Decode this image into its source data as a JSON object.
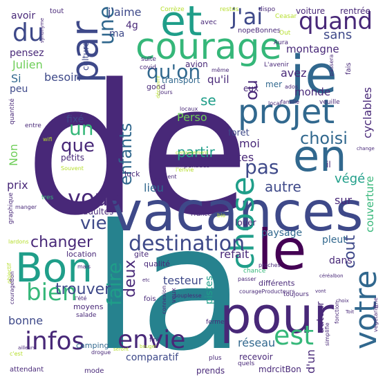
{
  "palette": {
    "dark": "#440154",
    "purple": "#482878",
    "indigo": "#3e4989",
    "blue": "#31688e",
    "teal": "#26828e",
    "green": "#1f9e89",
    "lime": "#35b779",
    "lightgreen": "#6ece58",
    "yellow": "#b5de2b",
    "brightyellow": "#fde725"
  },
  "words": [
    {
      "text": "de",
      "color": "purple"
    },
    {
      "text": "la",
      "color": "teal"
    },
    {
      "text": "vacances",
      "color": "indigo"
    },
    {
      "text": "pour",
      "color": "purple"
    },
    {
      "text": "courage",
      "color": "lime"
    },
    {
      "text": "et",
      "color": "green"
    },
    {
      "text": "je",
      "color": "blue"
    },
    {
      "text": "Bon",
      "color": "green"
    },
    {
      "text": "le",
      "color": "dark"
    },
    {
      "text": "en",
      "color": "blue"
    },
    {
      "text": "par",
      "color": "indigo"
    },
    {
      "text": "projet",
      "color": "blue"
    },
    {
      "text": "chose",
      "color": "green"
    },
    {
      "text": "votre",
      "color": "blue"
    },
    {
      "text": "du",
      "color": "indigo"
    },
    {
      "text": "quand",
      "color": "purple"
    },
    {
      "text": "j'ai",
      "color": "indigo"
    },
    {
      "text": "une",
      "color": "blue"
    },
    {
      "text": "qu'on",
      "color": "blue"
    },
    {
      "text": "destination",
      "color": "indigo"
    },
    {
      "text": "envie",
      "color": "purple"
    },
    {
      "text": "infos",
      "color": "purple"
    },
    {
      "text": "est",
      "color": "lime"
    },
    {
      "text": "bien",
      "color": "lime"
    },
    {
      "text": "faire",
      "color": "green"
    },
    {
      "text": "vous",
      "color": "purple"
    },
    {
      "text": "vie",
      "color": "indigo"
    },
    {
      "text": "pas",
      "color": "indigo"
    },
    {
      "text": "enfants",
      "color": "blue"
    },
    {
      "text": "un",
      "color": "lime"
    },
    {
      "text": "que",
      "color": "purple"
    },
    {
      "text": "choisi",
      "color": "blue"
    },
    {
      "text": "changer",
      "color": "purple"
    },
    {
      "text": "trouver",
      "color": "indigo"
    },
    {
      "text": "deux",
      "color": "purple"
    },
    {
      "text": "partir",
      "color": "green"
    },
    {
      "text": "autre",
      "color": "indigo"
    },
    {
      "text": "cout",
      "color": "indigo"
    },
    {
      "text": "ou",
      "color": "purple"
    },
    {
      "text": "se",
      "color": "green"
    },
    {
      "text": "refait",
      "color": "purple"
    },
    {
      "text": "testeur",
      "color": "indigo"
    },
    {
      "text": "bonne",
      "color": "indigo"
    },
    {
      "text": "réseau",
      "color": "blue"
    },
    {
      "text": "autour",
      "color": "purple"
    },
    {
      "text": "d'un",
      "color": "purple"
    },
    {
      "text": "prix",
      "color": "purple"
    },
    {
      "text": "lieu",
      "color": "blue"
    },
    {
      "text": "végé",
      "color": "green"
    },
    {
      "text": "couverture",
      "color": "lime"
    },
    {
      "text": "visites",
      "color": "purple"
    },
    {
      "text": "moi",
      "color": "purple"
    },
    {
      "text": "pistes",
      "color": "green"
    },
    {
      "text": "sur",
      "color": "purple"
    },
    {
      "text": "dans",
      "color": "purple"
    },
    {
      "text": "paysage",
      "color": "blue"
    },
    {
      "text": "pleut",
      "color": "blue"
    },
    {
      "text": "fixé",
      "color": "indigo"
    },
    {
      "text": "Perso",
      "color": "lightgreen"
    },
    {
      "text": "foret",
      "color": "indigo"
    },
    {
      "text": "monde",
      "color": "purple"
    },
    {
      "text": "cyclables",
      "color": "purple"
    },
    {
      "text": "sans",
      "color": "indigo"
    },
    {
      "text": "montagne",
      "color": "purple"
    },
    {
      "text": "avez",
      "color": "purple"
    },
    {
      "text": "qu'il",
      "color": "purple"
    },
    {
      "text": "besoin",
      "color": "indigo"
    },
    {
      "text": "Julien",
      "color": "lightgreen"
    },
    {
      "text": "Si",
      "color": "blue"
    },
    {
      "text": "peu",
      "color": "indigo"
    },
    {
      "text": "pensez",
      "color": "purple"
    },
    {
      "text": "avoir",
      "color": "purple"
    },
    {
      "text": "j'aime",
      "color": "indigo"
    },
    {
      "text": "4g",
      "color": "purple"
    },
    {
      "text": "ma",
      "color": "indigo"
    },
    {
      "text": "culture",
      "color": "indigo"
    },
    {
      "text": "Non",
      "color": "lightgreen"
    },
    {
      "text": "eux",
      "color": "purple"
    },
    {
      "text": "mer",
      "color": "blue"
    },
    {
      "text": "transport",
      "color": "blue"
    },
    {
      "text": "voiture",
      "color": "purple"
    },
    {
      "text": "rentrée",
      "color": "purple"
    },
    {
      "text": "nopeBonnes",
      "color": "purple"
    },
    {
      "text": "petits",
      "color": "purple"
    },
    {
      "text": "adultes",
      "color": "purple"
    },
    {
      "text": "comparatif",
      "color": "indigo"
    },
    {
      "text": "recevoir",
      "color": "purple"
    },
    {
      "text": "mdrcitBon",
      "color": "purple"
    },
    {
      "text": "prends",
      "color": "purple"
    },
    {
      "text": "attendant",
      "color": "purple"
    },
    {
      "text": "mode",
      "color": "purple"
    },
    {
      "text": "camping",
      "color": "blue"
    },
    {
      "text": "location",
      "color": "purple"
    },
    {
      "text": "gite",
      "color": "purple"
    },
    {
      "text": "qualité",
      "color": "purple"
    },
    {
      "text": "fois",
      "color": "purple"
    },
    {
      "text": "moyens",
      "color": "purple"
    },
    {
      "text": "salade",
      "color": "purple"
    },
    {
      "text": "différents",
      "color": "purple"
    },
    {
      "text": "toujours",
      "color": "purple"
    },
    {
      "text": "louer",
      "color": "purple"
    },
    {
      "text": "luck",
      "color": "purple"
    },
    {
      "text": "avion",
      "color": "purple"
    },
    {
      "text": "good",
      "color": "purple"
    },
    {
      "text": "tout",
      "color": "purple"
    },
    {
      "text": "avec",
      "color": "purple"
    },
    {
      "text": "il",
      "color": "purple"
    },
    {
      "text": "tres",
      "color": "lime"
    },
    {
      "text": "fermes",
      "color": "purple"
    },
    {
      "text": "fini",
      "color": "purple"
    },
    {
      "text": "plus",
      "color": "purple"
    },
    {
      "text": "quels",
      "color": "purple"
    },
    {
      "text": "entre",
      "color": "purple"
    },
    {
      "text": "quantité",
      "color": "purple"
    },
    {
      "text": "France",
      "color": "purple"
    },
    {
      "text": "chance",
      "color": "lime"
    },
    {
      "text": "veux",
      "color": "purple"
    },
    {
      "text": "Corrèze",
      "color": "yellow"
    },
    {
      "text": "restos",
      "color": "yellow"
    },
    {
      "text": "dispo",
      "color": "purple"
    },
    {
      "text": "Ceasar",
      "color": "yellow"
    },
    {
      "text": "Out",
      "color": "yellow"
    },
    {
      "text": "Aura",
      "color": "purple"
    },
    {
      "text": "L'avenir",
      "color": "purple"
    },
    {
      "text": "covid",
      "color": "purple"
    },
    {
      "text": "suite",
      "color": "purple"
    },
    {
      "text": "même",
      "color": "purple"
    },
    {
      "text": "jours",
      "color": "purple"
    },
    {
      "text": "ados",
      "color": "purple"
    },
    {
      "text": "famille",
      "color": "purple"
    },
    {
      "text": "veuille",
      "color": "purple"
    },
    {
      "text": "local",
      "color": "purple"
    },
    {
      "text": "locaux",
      "color": "purple"
    },
    {
      "text": "certainement",
      "color": "yellow"
    },
    {
      "text": "RasNonBonnes",
      "color": "purple"
    },
    {
      "text": "pensées",
      "color": "purple"
    },
    {
      "text": "l'envie",
      "color": "yellow"
    },
    {
      "text": "ont",
      "color": "purple"
    },
    {
      "text": "tiennent",
      "color": "purple"
    },
    {
      "text": "wifi",
      "color": "yellow"
    },
    {
      "text": "Souvent",
      "color": "yellow"
    },
    {
      "text": "bio",
      "color": "yellow"
    },
    {
      "text": "graphique",
      "color": "purple"
    },
    {
      "text": "manger",
      "color": "purple"
    },
    {
      "text": "lardons",
      "color": "yellow"
    },
    {
      "text": "objectif",
      "color": "yellow"
    },
    {
      "text": "mais",
      "color": "purple"
    },
    {
      "text": "l'été",
      "color": "purple"
    },
    {
      "text": "courageBon",
      "color": "purple"
    },
    {
      "text": "courageProducteurs",
      "color": "purple"
    },
    {
      "text": "souplesse",
      "color": "purple"
    },
    {
      "text": "connexion",
      "color": "purple"
    },
    {
      "text": "passer",
      "color": "purple"
    },
    {
      "text": "proches",
      "color": "purple"
    },
    {
      "text": "céréalbon",
      "color": "purple"
    },
    {
      "text": "végétarisme",
      "color": "purple"
    },
    {
      "text": "simplifie",
      "color": "purple"
    },
    {
      "text": "fonction",
      "color": "purple"
    },
    {
      "text": "seront",
      "color": "yellow"
    },
    {
      "text": "bouger",
      "color": "yellow"
    },
    {
      "text": "drogue",
      "color": "purple"
    },
    {
      "text": "c'est",
      "color": "yellow"
    },
    {
      "text": "ailleurs",
      "color": "purple"
    },
    {
      "text": "synonyme",
      "color": "purple"
    },
    {
      "text": "découvrir",
      "color": "yellow"
    },
    {
      "text": "passera",
      "color": "purple"
    },
    {
      "text": "fais",
      "color": "purple"
    },
    {
      "text": "etc",
      "color": "purple"
    },
    {
      "text": "change",
      "color": "purple"
    },
    {
      "text": "vont",
      "color": "purple"
    },
    {
      "text": "choix",
      "color": "purple"
    },
    {
      "text": "Toit",
      "color": "purple"
    },
    {
      "text": "ici",
      "color": "purple"
    }
  ]
}
